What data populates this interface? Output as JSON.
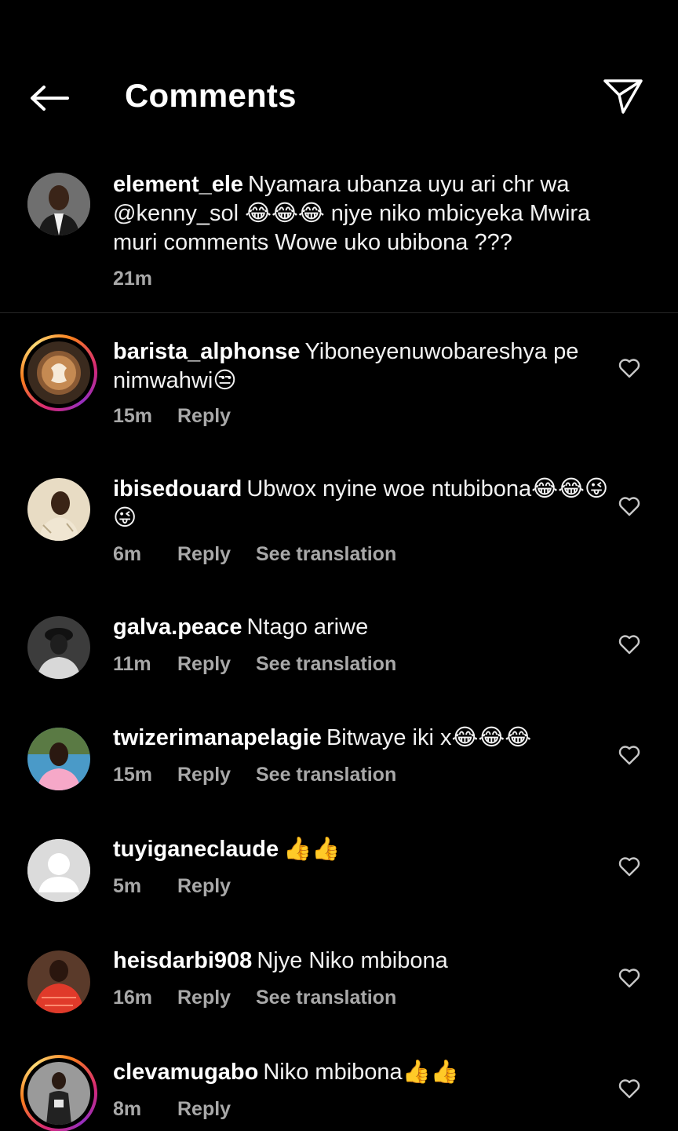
{
  "header": {
    "title": "Comments"
  },
  "caption": {
    "username": "element_ele",
    "text": "Nyamara ubanza uyu ari chr wa @kenny_sol 😂😂😂 njye niko mbicyeka Mwira muri comments Wowe uko ubibona ???",
    "time": "21m"
  },
  "comments": [
    {
      "username": "barista_alphonse",
      "text": "Yiboneyenuwobareshya pe nimwahwi😒",
      "time": "15m",
      "reply": "Reply",
      "translation": ""
    },
    {
      "username": "ibisedouard",
      "text": "Ubwox nyine woe ntubibona😂😂😜😜",
      "time": "6m",
      "reply": "Reply",
      "translation": "See translation"
    },
    {
      "username": "galva.peace",
      "text": "Ntago ariwe",
      "time": "11m",
      "reply": "Reply",
      "translation": "See translation"
    },
    {
      "username": "twizerimanapelagie",
      "text": "Bitwaye iki x😂😂😂",
      "time": "15m",
      "reply": "Reply",
      "translation": "See translation"
    },
    {
      "username": "tuyiganeclaude",
      "text": "👍👍",
      "time": "5m",
      "reply": "Reply",
      "translation": ""
    },
    {
      "username": "heisdarbi908",
      "text": "Njye Niko mbibona",
      "time": "16m",
      "reply": "Reply",
      "translation": "See translation"
    },
    {
      "username": "clevamugabo",
      "text": "Niko mbibona👍👍",
      "time": "8m",
      "reply": "Reply",
      "translation": ""
    }
  ],
  "colors": {
    "background": "#000000",
    "text": "#f5f5f5",
    "meta": "#a8a8a8",
    "divider": "#262626"
  },
  "icons": {
    "back": "arrow-left-icon",
    "send": "paper-plane-icon",
    "like": "heart-outline-icon"
  }
}
